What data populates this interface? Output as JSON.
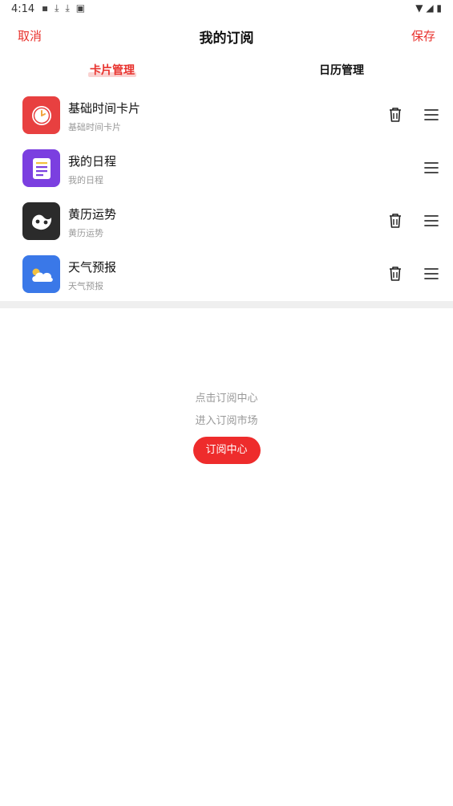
{
  "status_bar": {
    "time": "4:14",
    "left_icons": [
      "notification-icon",
      "download-icon",
      "download-icon",
      "app-icon"
    ],
    "right_icons": [
      "wifi-icon",
      "signal-icon",
      "battery-icon"
    ]
  },
  "nav": {
    "cancel": "取消",
    "title": "我的订阅",
    "save": "保存"
  },
  "tabs": {
    "active": "卡片管理",
    "inactive": "日历管理"
  },
  "cards": [
    {
      "title": "基础时间卡片",
      "subtitle": "基础时间卡片",
      "icon": "clock-icon",
      "color": "#e84040",
      "deletable": true
    },
    {
      "title": "我的日程",
      "subtitle": "我的日程",
      "icon": "notes-icon",
      "color": "#7b3fe0",
      "deletable": false
    },
    {
      "title": "黄历运势",
      "subtitle": "黄历运势",
      "icon": "yinyang-icon",
      "color": "#2b2b2b",
      "deletable": true
    },
    {
      "title": "天气预报",
      "subtitle": "天气预报",
      "icon": "weather-icon",
      "color": "#3a78e8",
      "deletable": true
    }
  ],
  "empty": {
    "line1": "点击订阅中心",
    "line2": "进入订阅市场",
    "button": "订阅中心"
  },
  "colors": {
    "accent": "#e8322d",
    "button": "#ee2c2c"
  }
}
